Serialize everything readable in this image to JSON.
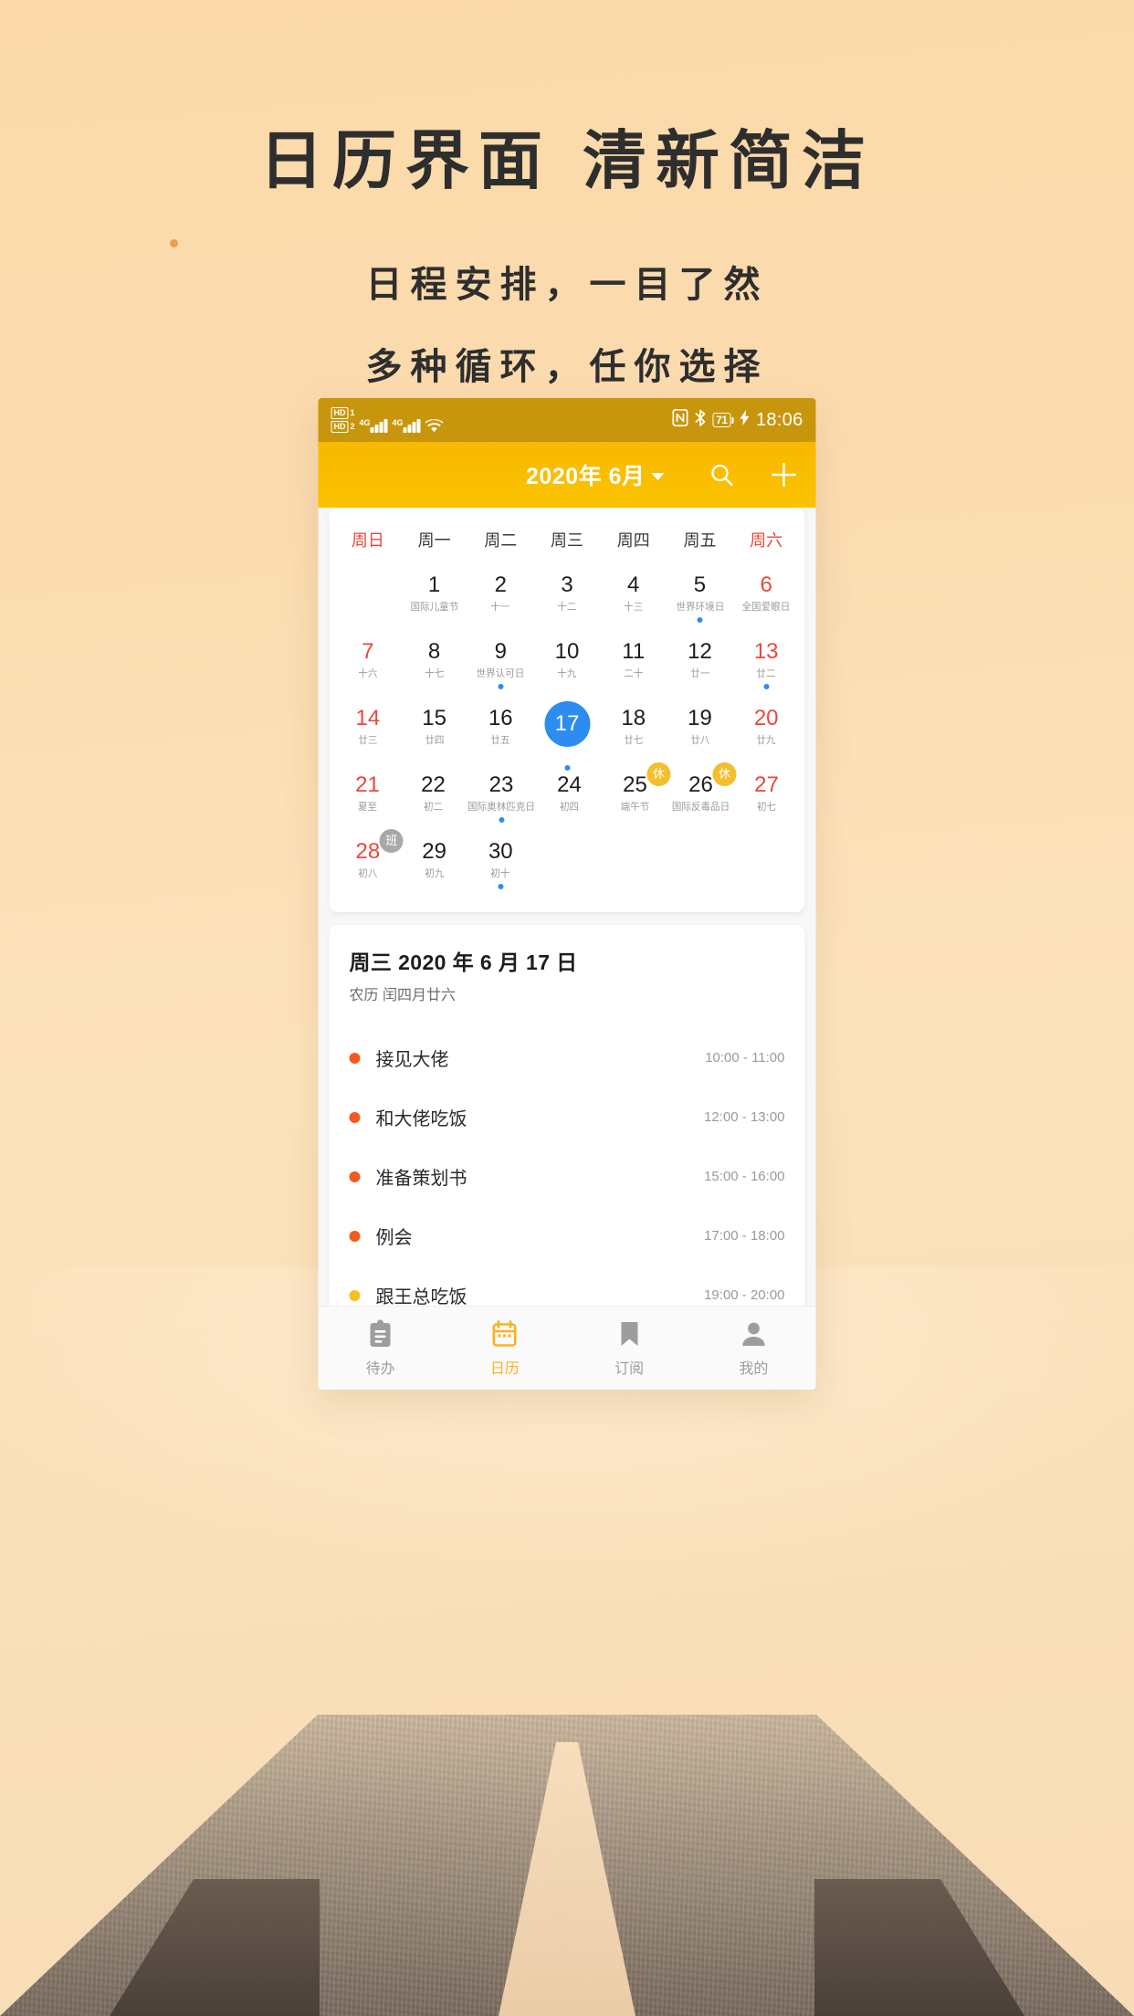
{
  "promo": {
    "title_left": "日历界面",
    "title_right": "清新简洁",
    "subtitle1": "日程安排，一目了然",
    "subtitle2": "多种循环，任你选择"
  },
  "colors": {
    "accent": "#f9b222",
    "statusbar": "#c8960c",
    "appbar": "#fcc200",
    "selected_day": "#2c8cf0",
    "weekend": "#e8483c",
    "rest_badge": "#f5be2c",
    "work_badge": "#a9a9a9",
    "event_orange": "#f4591f",
    "event_yellow": "#f5c020"
  },
  "statusbar": {
    "hd1_label": "HD",
    "hd1_num": "1",
    "hd2_label": "HD",
    "hd2_num": "2",
    "net1": "4G",
    "net2": "4G",
    "wifi_icon": "wifi-icon",
    "nfc_icon": "nfc-icon",
    "bluetooth_icon": "bluetooth-icon",
    "battery_level": "71",
    "charging_icon": "charging-bolt-icon",
    "time": "18:06"
  },
  "appbar": {
    "month_title": "2020年 6月",
    "dropdown_icon": "chevron-down-icon",
    "search_icon": "search-icon",
    "add_icon": "plus-icon"
  },
  "calendar": {
    "weekdays": [
      {
        "label": "周日",
        "weekend": true
      },
      {
        "label": "周一",
        "weekend": false
      },
      {
        "label": "周二",
        "weekend": false
      },
      {
        "label": "周三",
        "weekend": false
      },
      {
        "label": "周四",
        "weekend": false
      },
      {
        "label": "周五",
        "weekend": false
      },
      {
        "label": "周六",
        "weekend": true
      }
    ],
    "rows": [
      [
        {
          "day": "",
          "lunar": "",
          "weekend": true,
          "dot": false,
          "badge": null,
          "selected": false,
          "empty": true
        },
        {
          "day": "1",
          "lunar": "国际儿童节",
          "weekend": false,
          "dot": false,
          "badge": null,
          "selected": false
        },
        {
          "day": "2",
          "lunar": "十一",
          "weekend": false,
          "dot": false,
          "badge": null,
          "selected": false
        },
        {
          "day": "3",
          "lunar": "十二",
          "weekend": false,
          "dot": false,
          "badge": null,
          "selected": false
        },
        {
          "day": "4",
          "lunar": "十三",
          "weekend": false,
          "dot": false,
          "badge": null,
          "selected": false
        },
        {
          "day": "5",
          "lunar": "世界环境日",
          "weekend": false,
          "dot": true,
          "badge": null,
          "selected": false
        },
        {
          "day": "6",
          "lunar": "全国爱眼日",
          "weekend": true,
          "dot": false,
          "badge": null,
          "selected": false
        }
      ],
      [
        {
          "day": "7",
          "lunar": "十六",
          "weekend": true,
          "dot": false,
          "badge": null,
          "selected": false
        },
        {
          "day": "8",
          "lunar": "十七",
          "weekend": false,
          "dot": false,
          "badge": null,
          "selected": false
        },
        {
          "day": "9",
          "lunar": "世界认可日",
          "weekend": false,
          "dot": true,
          "badge": null,
          "selected": false
        },
        {
          "day": "10",
          "lunar": "十九",
          "weekend": false,
          "dot": false,
          "badge": null,
          "selected": false
        },
        {
          "day": "11",
          "lunar": "二十",
          "weekend": false,
          "dot": false,
          "badge": null,
          "selected": false
        },
        {
          "day": "12",
          "lunar": "廿一",
          "weekend": false,
          "dot": false,
          "badge": null,
          "selected": false
        },
        {
          "day": "13",
          "lunar": "廿二",
          "weekend": true,
          "dot": true,
          "badge": null,
          "selected": false
        }
      ],
      [
        {
          "day": "14",
          "lunar": "廿三",
          "weekend": true,
          "dot": false,
          "badge": null,
          "selected": false
        },
        {
          "day": "15",
          "lunar": "廿四",
          "weekend": false,
          "dot": false,
          "badge": null,
          "selected": false
        },
        {
          "day": "16",
          "lunar": "廿五",
          "weekend": false,
          "dot": false,
          "badge": null,
          "selected": false
        },
        {
          "day": "17",
          "lunar": "廿六",
          "weekend": false,
          "dot": true,
          "badge": null,
          "selected": true
        },
        {
          "day": "18",
          "lunar": "廿七",
          "weekend": false,
          "dot": false,
          "badge": null,
          "selected": false
        },
        {
          "day": "19",
          "lunar": "廿八",
          "weekend": false,
          "dot": false,
          "badge": null,
          "selected": false
        },
        {
          "day": "20",
          "lunar": "廿九",
          "weekend": true,
          "dot": false,
          "badge": null,
          "selected": false
        }
      ],
      [
        {
          "day": "21",
          "lunar": "夏至",
          "weekend": true,
          "dot": false,
          "badge": null,
          "selected": false
        },
        {
          "day": "22",
          "lunar": "初二",
          "weekend": false,
          "dot": false,
          "badge": null,
          "selected": false
        },
        {
          "day": "23",
          "lunar": "国际奥林匹克日",
          "weekend": false,
          "dot": true,
          "badge": null,
          "selected": false
        },
        {
          "day": "24",
          "lunar": "初四",
          "weekend": false,
          "dot": false,
          "badge": null,
          "selected": false
        },
        {
          "day": "25",
          "lunar": "端午节",
          "weekend": false,
          "dot": false,
          "badge": {
            "text": "休",
            "kind": "rest"
          },
          "selected": false
        },
        {
          "day": "26",
          "lunar": "国际反毒品日",
          "weekend": false,
          "dot": false,
          "badge": {
            "text": "休",
            "kind": "rest"
          },
          "selected": false
        },
        {
          "day": "27",
          "lunar": "初七",
          "weekend": true,
          "dot": false,
          "badge": null,
          "selected": false
        }
      ],
      [
        {
          "day": "28",
          "lunar": "初八",
          "weekend": true,
          "dot": false,
          "badge": {
            "text": "班",
            "kind": "work"
          },
          "selected": false
        },
        {
          "day": "29",
          "lunar": "初九",
          "weekend": false,
          "dot": false,
          "badge": null,
          "selected": false
        },
        {
          "day": "30",
          "lunar": "初十",
          "weekend": false,
          "dot": true,
          "badge": null,
          "selected": false
        },
        {
          "day": "",
          "lunar": "",
          "weekend": false,
          "dot": false,
          "badge": null,
          "selected": false,
          "empty": true
        },
        {
          "day": "",
          "lunar": "",
          "weekend": false,
          "dot": false,
          "badge": null,
          "selected": false,
          "empty": true
        },
        {
          "day": "",
          "lunar": "",
          "weekend": false,
          "dot": false,
          "badge": null,
          "selected": false,
          "empty": true
        },
        {
          "day": "",
          "lunar": "",
          "weekend": true,
          "dot": false,
          "badge": null,
          "selected": false,
          "empty": true
        }
      ]
    ]
  },
  "schedule": {
    "date_line": "周三  2020 年 6 月 17 日",
    "lunar_line": "农历 闰四月廿六",
    "events": [
      {
        "title": "接见大佬",
        "time": "10:00 - 11:00",
        "color": "#f4591f"
      },
      {
        "title": "和大佬吃饭",
        "time": "12:00 - 13:00",
        "color": "#f4591f"
      },
      {
        "title": "准备策划书",
        "time": "15:00 - 16:00",
        "color": "#f4591f"
      },
      {
        "title": "例会",
        "time": "17:00 - 18:00",
        "color": "#f4591f"
      },
      {
        "title": "跟王总吃饭",
        "time": "19:00 - 20:00",
        "color": "#f5c020"
      }
    ]
  },
  "tabbar": {
    "items": [
      {
        "label": "待办",
        "icon": "clipboard-icon",
        "active": false
      },
      {
        "label": "日历",
        "icon": "calendar-icon",
        "active": true
      },
      {
        "label": "订阅",
        "icon": "bookmark-icon",
        "active": false
      },
      {
        "label": "我的",
        "icon": "person-icon",
        "active": false
      }
    ]
  }
}
